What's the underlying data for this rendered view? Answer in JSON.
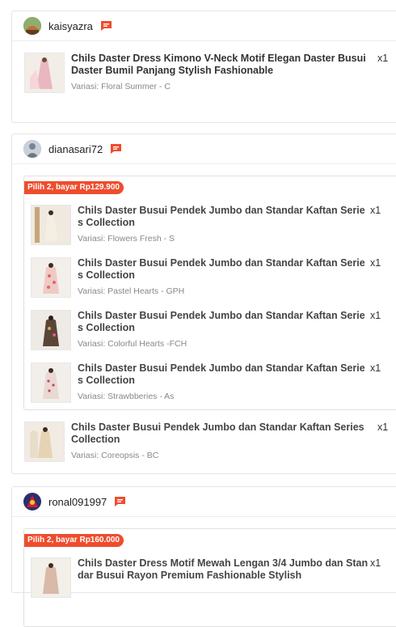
{
  "orders": [
    {
      "username": "kaisyazra",
      "avatar_color": "#c96a3a",
      "items": [
        {
          "name": "Chils Daster Dress Kimono V-Neck Motif Elegan Daster Busui Daster Bumil Panjang Stylish Fashionable",
          "variant": "Variasi: Floral Summer - C",
          "qty": "x1"
        }
      ]
    },
    {
      "username": "dianasari72",
      "avatar_color": "#8a97a8",
      "bundle_label": "Pilih 2, bayar Rp129.900",
      "bundle_items": [
        {
          "name": "Chils Daster Busui Pendek Jumbo dan Standar Kaftan Series Collection",
          "variant": "Variasi: Flowers Fresh - S",
          "qty": "x1"
        },
        {
          "name": "Chils Daster Busui Pendek Jumbo dan Standar Kaftan Series Collection",
          "variant": "Variasi: Pastel Hearts - GPH",
          "qty": "x1"
        },
        {
          "name": "Chils Daster Busui Pendek Jumbo dan Standar Kaftan Series Collection",
          "variant": "Variasi: Colorful Hearts -FCH",
          "qty": "x1"
        },
        {
          "name": "Chils Daster Busui Pendek Jumbo dan Standar Kaftan Series Collection",
          "variant": "Variasi: Strawbberies - As",
          "qty": "x1"
        }
      ],
      "items": [
        {
          "name": "Chils Daster Busui Pendek Jumbo dan Standar Kaftan Series Collection",
          "variant": "Variasi: Coreopsis - BC",
          "qty": "x1"
        }
      ]
    },
    {
      "username": "ronal091997",
      "avatar_color": "#b3262b",
      "bundle_label": "Pilih 2, bayar Rp160.000",
      "bundle_items": [
        {
          "name": "Chils Daster Dress Motif Mewah Lengan 3/4 Jumbo dan Standar Busui Rayon Premium Fashionable Stylish",
          "qty": "x1"
        }
      ]
    }
  ],
  "colors": {
    "accent": "#ee4d2d"
  },
  "icons": {
    "chat": "chat-bubble-icon"
  }
}
